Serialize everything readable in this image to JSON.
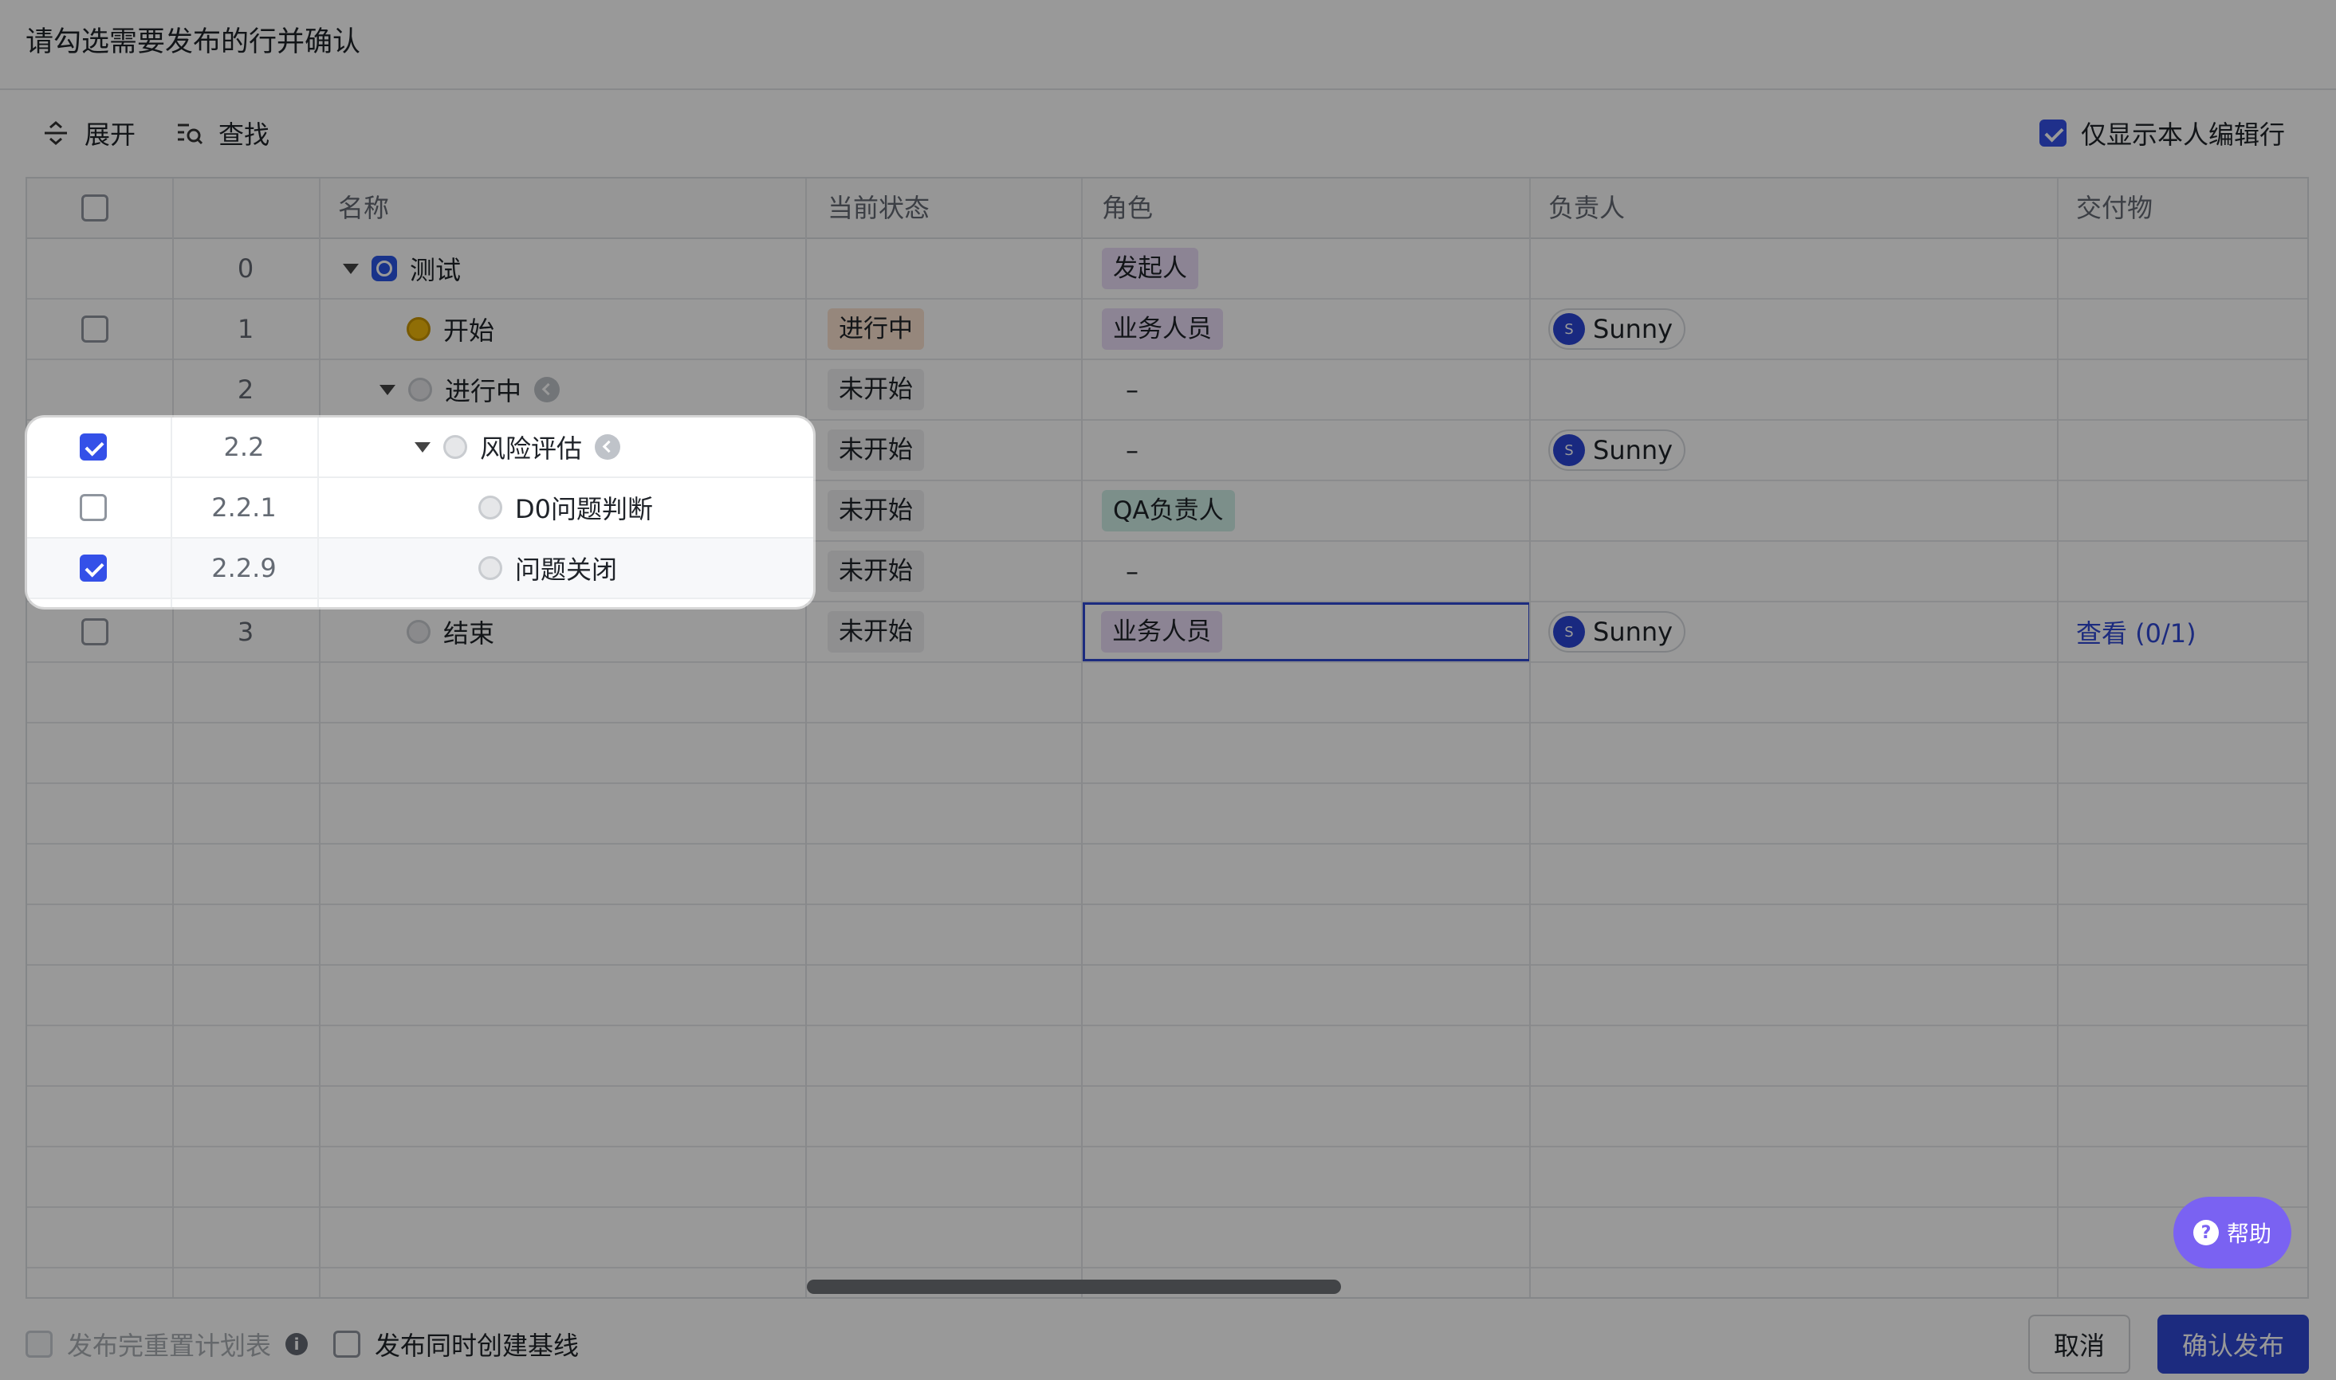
{
  "title": "请勾选需要发布的行并确认",
  "toolbar": {
    "expand_label": "展开",
    "find_label": "查找",
    "only_mine_label": "仅显示本人编辑行",
    "only_mine_checked": true
  },
  "columns": [
    "名称",
    "当前状态",
    "角色",
    "负责人",
    "交付物"
  ],
  "rows": [
    {
      "index": "0",
      "name": "测试",
      "status": "",
      "role": "发起人",
      "owner": "",
      "deliverable": "",
      "checked": null
    },
    {
      "index": "1",
      "name": "开始",
      "status": "进行中",
      "role": "业务人员",
      "owner": "Sunny",
      "deliverable": "",
      "checked": false
    },
    {
      "index": "2",
      "name": "进行中",
      "status": "未开始",
      "role": "–",
      "owner": "",
      "deliverable": "",
      "checked": null
    },
    {
      "index": "2.2",
      "name": "风险评估",
      "status": "未开始",
      "role": "–",
      "owner": "Sunny",
      "deliverable": "",
      "checked": true
    },
    {
      "index": "2.2.1",
      "name": "D0问题判断",
      "status": "未开始",
      "role": "QA负责人",
      "owner": "",
      "deliverable": "",
      "checked": false
    },
    {
      "index": "2.2.9",
      "name": "问题关闭",
      "status": "未开始",
      "role": "–",
      "owner": "",
      "deliverable": "",
      "checked": true
    },
    {
      "index": "3",
      "name": "结束",
      "status": "未开始",
      "role": "业务人员",
      "owner": "Sunny",
      "deliverable": "查看 (0/1)",
      "checked": false
    }
  ],
  "avatar_letter": "S",
  "footer": {
    "reset_plan_label": "发布完重置计划表",
    "baseline_label": "发布同时创建基线",
    "cancel_label": "取消",
    "confirm_label": "确认发布"
  },
  "help": {
    "label": "帮助",
    "glyph": "?"
  },
  "info_glyph": "i",
  "colors": {
    "accent": "#2f48d4",
    "checkbox": "#3450e8",
    "status_in_progress_bg": "#fbe1cf",
    "status_not_started_bg": "#eeeff1",
    "role_purple_bg": "#eadcf7",
    "role_green_bg": "#cfeee7",
    "link": "#2f48d4",
    "help_bg": "#7a62f2"
  }
}
